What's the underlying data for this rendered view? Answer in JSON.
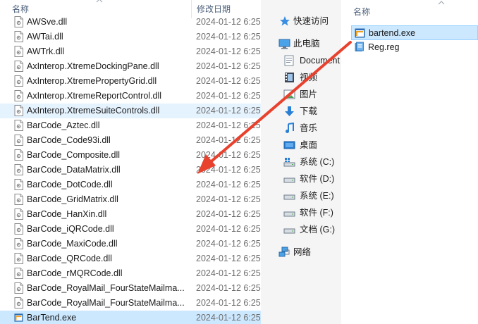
{
  "left": {
    "col_name": "名称",
    "col_date": "修改日期",
    "files": [
      {
        "name": "AWSve.dll",
        "date": "2024-01-12 6:25",
        "type": "dll"
      },
      {
        "name": "AWTai.dll",
        "date": "2024-01-12 6:25",
        "type": "dll"
      },
      {
        "name": "AWTrk.dll",
        "date": "2024-01-12 6:25",
        "type": "dll"
      },
      {
        "name": "AxInterop.XtremeDockingPane.dll",
        "date": "2024-01-12 6:25",
        "type": "dll"
      },
      {
        "name": "AxInterop.XtremePropertyGrid.dll",
        "date": "2024-01-12 6:25",
        "type": "dll"
      },
      {
        "name": "AxInterop.XtremeReportControl.dll",
        "date": "2024-01-12 6:25",
        "type": "dll"
      },
      {
        "name": "AxInterop.XtremeSuiteControls.dll",
        "date": "2024-01-12 6:25",
        "type": "dll",
        "hover": true
      },
      {
        "name": "BarCode_Aztec.dll",
        "date": "2024-01-12 6:25",
        "type": "dll"
      },
      {
        "name": "BarCode_Code93i.dll",
        "date": "2024-01-12 6:25",
        "type": "dll"
      },
      {
        "name": "BarCode_Composite.dll",
        "date": "2024-01-12 6:25",
        "type": "dll"
      },
      {
        "name": "BarCode_DataMatrix.dll",
        "date": "2024-01-12 6:25",
        "type": "dll"
      },
      {
        "name": "BarCode_DotCode.dll",
        "date": "2024-01-12 6:25",
        "type": "dll"
      },
      {
        "name": "BarCode_GridMatrix.dll",
        "date": "2024-01-12 6:25",
        "type": "dll"
      },
      {
        "name": "BarCode_HanXin.dll",
        "date": "2024-01-12 6:25",
        "type": "dll"
      },
      {
        "name": "BarCode_iQRCode.dll",
        "date": "2024-01-12 6:25",
        "type": "dll"
      },
      {
        "name": "BarCode_MaxiCode.dll",
        "date": "2024-01-12 6:25",
        "type": "dll"
      },
      {
        "name": "BarCode_QRCode.dll",
        "date": "2024-01-12 6:25",
        "type": "dll"
      },
      {
        "name": "BarCode_rMQRCode.dll",
        "date": "2024-01-12 6:25",
        "type": "dll"
      },
      {
        "name": "BarCode_RoyalMail_FourStateMailma...",
        "date": "2024-01-12 6:25",
        "type": "dll"
      },
      {
        "name": "BarCode_RoyalMail_FourStateMailma...",
        "date": "2024-01-12 6:25",
        "type": "dll"
      },
      {
        "name": "BarTend.exe",
        "date": "2024-01-12 6:25",
        "type": "exe",
        "selected": true
      }
    ]
  },
  "nav": {
    "items": [
      {
        "label": "快速访问",
        "icon": "star-icon",
        "kind": "quick"
      },
      {
        "label": "此电脑",
        "icon": "computer-icon",
        "kind": "pc"
      },
      {
        "label": "Document",
        "icon": "documents-folder-icon",
        "kind": "sub"
      },
      {
        "label": "视频",
        "icon": "videos-folder-icon",
        "kind": "sub"
      },
      {
        "label": "图片",
        "icon": "pictures-folder-icon",
        "kind": "sub"
      },
      {
        "label": "下载",
        "icon": "downloads-folder-icon",
        "kind": "sub"
      },
      {
        "label": "音乐",
        "icon": "music-folder-icon",
        "kind": "sub"
      },
      {
        "label": "桌面",
        "icon": "desktop-folder-icon",
        "kind": "sub"
      },
      {
        "label": "系统 (C:)",
        "icon": "system-drive-icon",
        "kind": "sub"
      },
      {
        "label": "软件 (D:)",
        "icon": "drive-icon",
        "kind": "sub"
      },
      {
        "label": "系统 (E:)",
        "icon": "drive-icon",
        "kind": "sub"
      },
      {
        "label": "软件 (F:)",
        "icon": "drive-icon",
        "kind": "sub"
      },
      {
        "label": "文档 (G:)",
        "icon": "drive-icon",
        "kind": "sub"
      },
      {
        "label": "网络",
        "icon": "network-icon",
        "kind": "net"
      }
    ]
  },
  "right": {
    "col_name": "名称",
    "files": [
      {
        "name": "bartend.exe",
        "type": "exe",
        "selected": true
      },
      {
        "name": "Reg.reg",
        "type": "reg"
      }
    ]
  },
  "colors": {
    "selection": "#cce8ff",
    "hover": "#e5f3ff",
    "arrow": "#e8412e",
    "nav_bg": "#f5f5f5"
  }
}
